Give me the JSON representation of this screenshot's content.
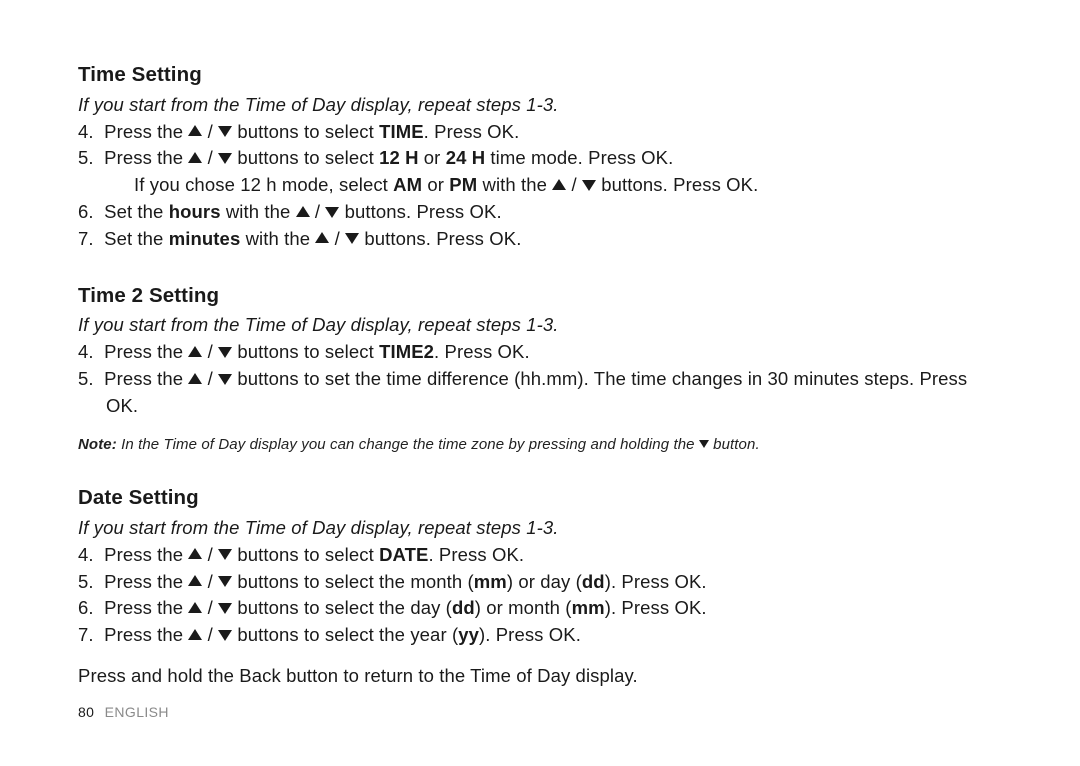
{
  "icons": {
    "up": "▲",
    "down": "▼",
    "sep": " / "
  },
  "time": {
    "heading": "Time Setting",
    "intro": "If you start from the Time of Day display, repeat steps 1-3.",
    "steps": [
      {
        "n": "4.",
        "pre": "Press the ",
        "mid": " buttons to select ",
        "boldA": "TIME",
        "post": ". Press OK."
      },
      {
        "n": "5.",
        "pre": "Press the ",
        "mid": " buttons to select ",
        "boldA": "12 H",
        "mid2": " or ",
        "boldB": "24 H",
        "post": " time mode. Press OK.",
        "sub": {
          "pre": "If you chose 12 h mode, select ",
          "boldA": "AM",
          "mid": " or ",
          "boldB": "PM",
          "mid2": " with the ",
          "post": " buttons. Press OK."
        }
      },
      {
        "n": "6.",
        "pre": "Set the ",
        "boldA": "hours",
        "mid": " with the ",
        "post": " buttons. Press OK."
      },
      {
        "n": "7.",
        "pre": "Set the ",
        "boldA": "minutes",
        "mid": " with the ",
        "post": " buttons. Press OK."
      }
    ]
  },
  "time2": {
    "heading": "Time 2 Setting",
    "intro": "If you start from the Time of Day display, repeat steps 1-3.",
    "steps": [
      {
        "n": "4.",
        "pre": "Press the ",
        "mid": " buttons to select ",
        "boldA": "TIME2",
        "post": ". Press OK."
      },
      {
        "n": "5.",
        "pre": "Press the ",
        "post": " buttons to set the time difference (hh.mm). The time changes in 30 minutes steps. Press OK."
      }
    ],
    "note": {
      "label": "Note:",
      "pre": " In the Time of Day display you can change the time zone by pressing and holding the ",
      "post": " button."
    }
  },
  "date": {
    "heading": "Date Setting",
    "intro": "If you start from the Time of Day display, repeat steps 1-3.",
    "steps": [
      {
        "n": "4.",
        "pre": "Press the ",
        "mid": " buttons to select ",
        "boldA": "DATE",
        "post": ". Press OK."
      },
      {
        "n": "5.",
        "pre": "Press the ",
        "mid": " buttons to select the month (",
        "boldA": "mm",
        "mid2": ") or day (",
        "boldB": "dd",
        "post": "). Press OK."
      },
      {
        "n": "6.",
        "pre": "Press the ",
        "mid": " buttons to select the day (",
        "boldA": "dd",
        "mid2": ") or month (",
        "boldB": "mm",
        "post": "). Press OK."
      },
      {
        "n": "7.",
        "pre": "Press the ",
        "mid": " buttons to select the year (",
        "boldA": "yy",
        "post": "). Press OK."
      }
    ],
    "closing": "Press and hold the Back button to return to the Time of Day display."
  },
  "footer": {
    "page": "80",
    "lang": "ENGLISH"
  }
}
